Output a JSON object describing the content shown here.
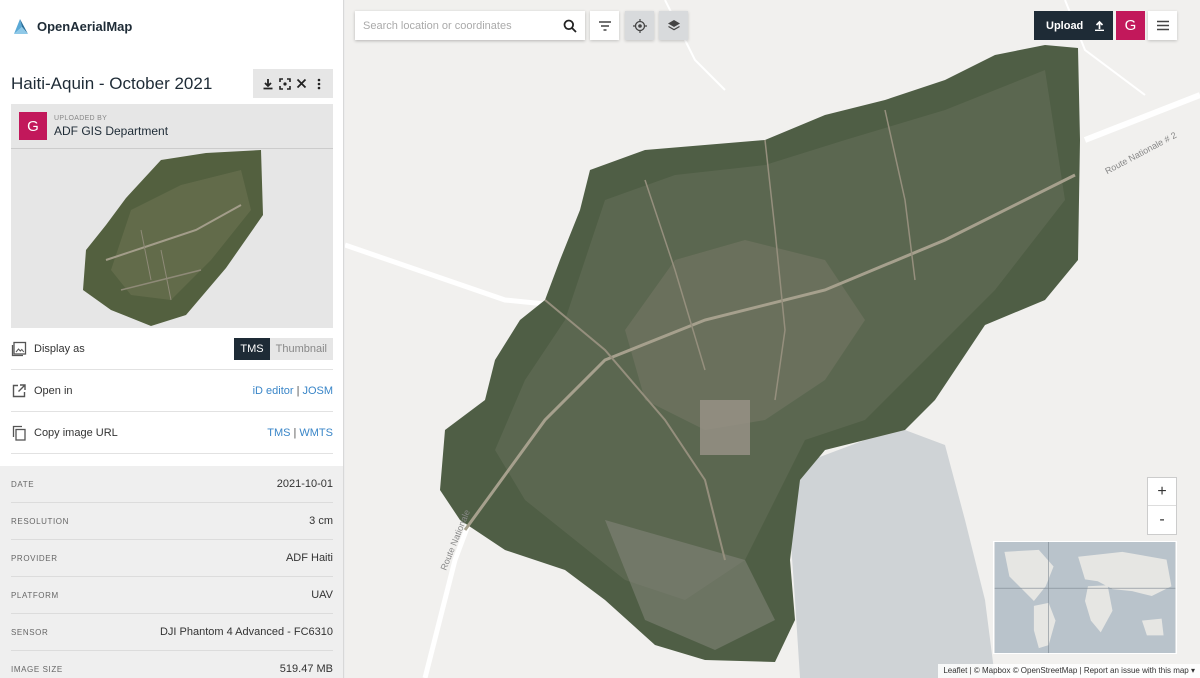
{
  "app": {
    "name": "OpenAerialMap"
  },
  "image": {
    "title": "Haiti-Aquin - October 2021"
  },
  "uploader": {
    "label": "UPLOADED BY",
    "name": "ADF GIS Department",
    "initial": "G"
  },
  "options": {
    "display_as": {
      "label": "Display as",
      "tms": "TMS",
      "thumbnail": "Thumbnail",
      "selected": "TMS"
    },
    "open_in": {
      "label": "Open in",
      "id_editor": "iD editor",
      "sep": "|",
      "josm": "JOSM"
    },
    "copy_url": {
      "label": "Copy image URL",
      "tms": "TMS",
      "sep": "|",
      "wmts": "WMTS"
    }
  },
  "metadata": [
    {
      "key": "DATE",
      "value": "2021-10-01"
    },
    {
      "key": "RESOLUTION",
      "value": "3 cm"
    },
    {
      "key": "PROVIDER",
      "value": "ADF Haiti"
    },
    {
      "key": "PLATFORM",
      "value": "UAV"
    },
    {
      "key": "SENSOR",
      "value": "DJI Phantom 4 Advanced - FC6310"
    },
    {
      "key": "IMAGE SIZE",
      "value": "519.47 MB"
    }
  ],
  "map": {
    "search_placeholder": "Search location or coordinates",
    "upload_label": "Upload",
    "user_initial": "G",
    "zoom_in": "+",
    "zoom_out": "-",
    "roads": {
      "east": "Route Nationale # 2",
      "west": "Route Nationale"
    },
    "attribution": {
      "leaflet": "Leaflet",
      "mapbox": "© Mapbox",
      "osm": "© OpenStreetMap",
      "report": "Report an issue with this map"
    }
  },
  "colors": {
    "brand_dark": "#1e2b36",
    "accent_pink": "#c2185b",
    "link_blue": "#3a86c8",
    "water": "#cfd3d6",
    "imagery": "#4f5e45"
  },
  "icons": [
    "logo-icon",
    "download-icon",
    "fullscreen-icon",
    "close-icon",
    "more-icon",
    "image-icon",
    "external-link-icon",
    "copy-icon",
    "search-icon",
    "filter-icon",
    "locate-icon",
    "layers-icon",
    "upload-icon",
    "hamburger-icon"
  ]
}
